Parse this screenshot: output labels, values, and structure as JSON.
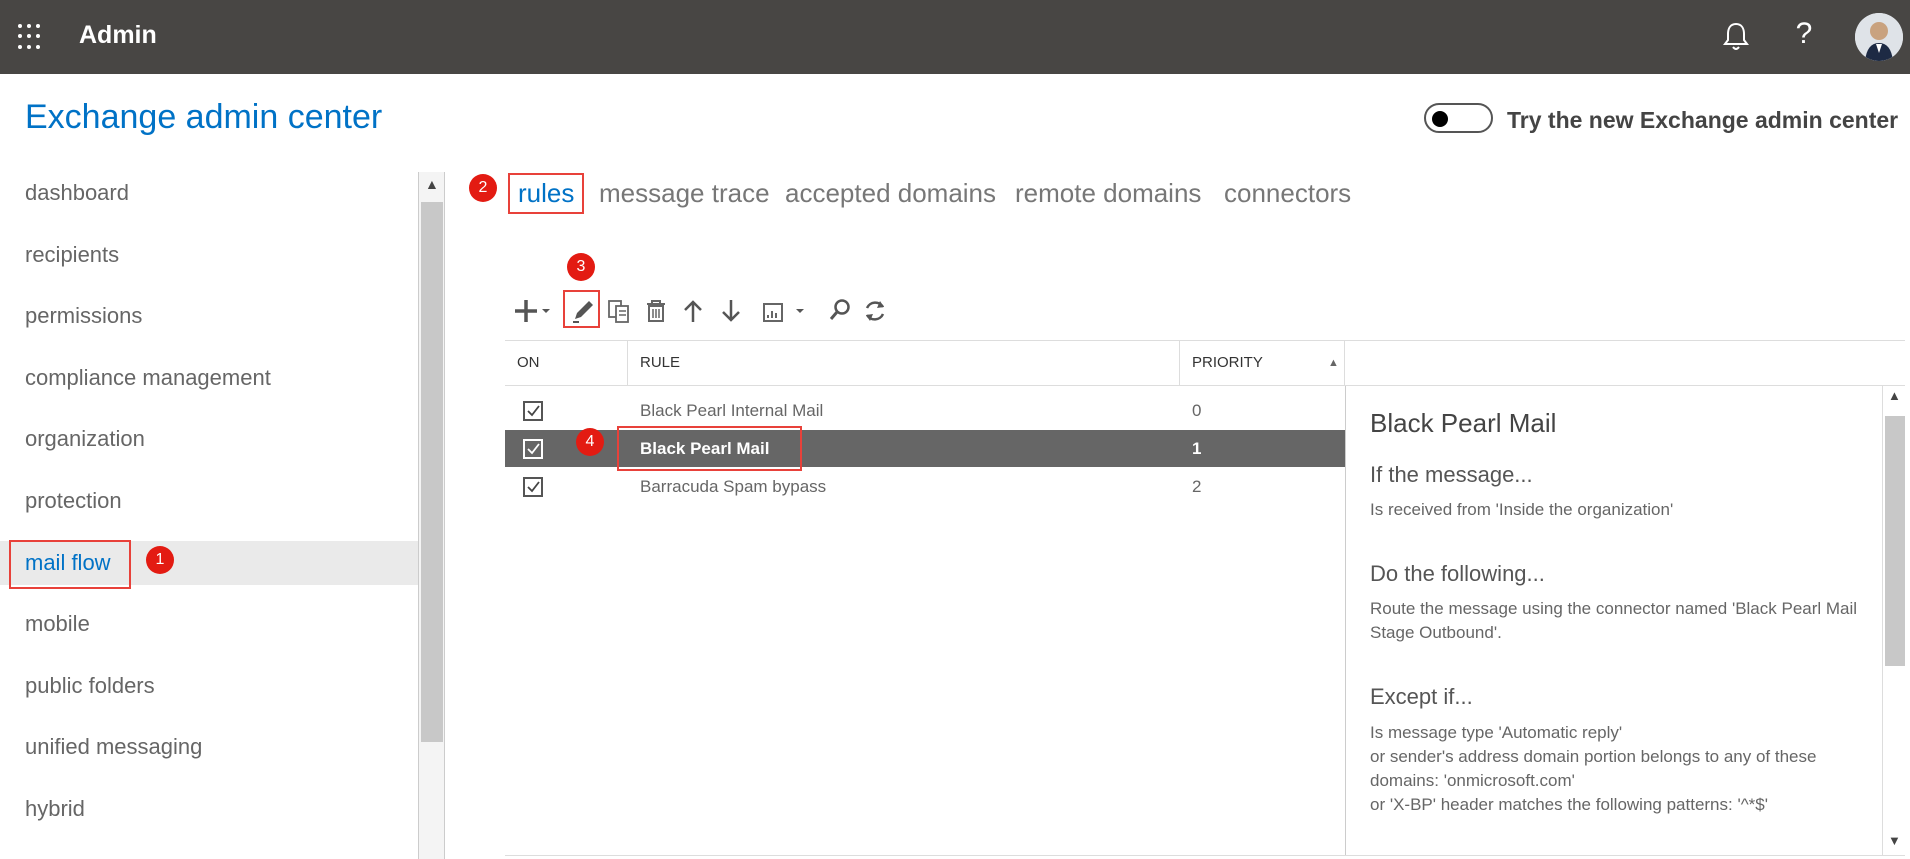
{
  "topbar": {
    "app_title": "Admin",
    "icons": [
      "app-launcher-icon",
      "bell-icon",
      "help-icon",
      "user-avatar"
    ],
    "help_glyph": "?"
  },
  "header": {
    "title": "Exchange admin center",
    "toggle_label": "Try the new Exchange admin center"
  },
  "nav": {
    "items": [
      {
        "label": "dashboard"
      },
      {
        "label": "recipients"
      },
      {
        "label": "permissions"
      },
      {
        "label": "compliance management"
      },
      {
        "label": "organization"
      },
      {
        "label": "protection"
      },
      {
        "label": "mail flow"
      },
      {
        "label": "mobile"
      },
      {
        "label": "public folders"
      },
      {
        "label": "unified messaging"
      },
      {
        "label": "hybrid"
      }
    ],
    "active": "mail flow"
  },
  "tabs": [
    {
      "label": "rules"
    },
    {
      "label": "message trace"
    },
    {
      "label": "accepted domains"
    },
    {
      "label": "remote domains"
    },
    {
      "label": "connectors"
    }
  ],
  "toolbar": {
    "icons": [
      "add-icon",
      "edit-icon",
      "copy-icon",
      "delete-icon",
      "move-up-icon",
      "move-down-icon",
      "report-icon",
      "search-icon",
      "refresh-icon"
    ]
  },
  "table": {
    "columns": [
      "ON",
      "RULE",
      "PRIORITY"
    ],
    "sort_column": "PRIORITY",
    "rows": [
      {
        "on": true,
        "rule": "Black Pearl Internal Mail",
        "priority": "0"
      },
      {
        "on": true,
        "rule": "Black Pearl Mail",
        "priority": "1"
      },
      {
        "on": true,
        "rule": "Barracuda Spam bypass",
        "priority": "2"
      }
    ],
    "selected_index": 1
  },
  "detail": {
    "title": "Black Pearl Mail",
    "if_heading": "If the message...",
    "if_text": "Is received from 'Inside the organization'",
    "do_heading": "Do the following...",
    "do_text": "Route the message using the connector named 'Black Pearl Mail Stage Outbound'.",
    "except_heading": "Except if...",
    "except_lines": [
      "Is message type 'Automatic reply'",
      "or sender's address domain portion belongs to any of these domains: 'onmicrosoft.com'",
      "or 'X-BP' header matches the following patterns: '^*$'"
    ]
  },
  "annotations": [
    "1",
    "2",
    "3",
    "4"
  ],
  "colors": {
    "topbar": "#484644",
    "accent": "#0072c6",
    "selected_row": "#666666",
    "annotation_red": "#e31b12"
  }
}
